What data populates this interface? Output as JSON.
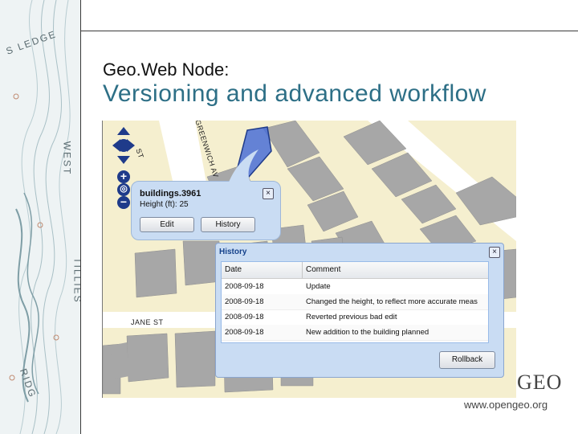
{
  "slide": {
    "subtitle": "Geo.Web Node:",
    "title": "Versioning and advanced workflow"
  },
  "decoration": {
    "topo_words": [
      "S LEDGE",
      "WEST",
      "TILLIES",
      "RIDG"
    ]
  },
  "map": {
    "streets": [
      "GREENWICH AV",
      "JANE ST",
      "ST"
    ]
  },
  "feature_popup": {
    "title": "buildings.3961",
    "height_text": "Height (ft): 25",
    "edit_label": "Edit",
    "history_label": "History",
    "close_icon": "close-icon"
  },
  "history_window": {
    "title": "History",
    "columns": [
      "Date",
      "Comment"
    ],
    "rows": [
      {
        "date": "2008-09-18",
        "comment": "Update"
      },
      {
        "date": "2008-09-18",
        "comment": "Changed the height, to reflect more accurate meas"
      },
      {
        "date": "2008-09-18",
        "comment": "Reverted previous bad edit"
      },
      {
        "date": "2008-09-18",
        "comment": "New addition to the building planned"
      }
    ],
    "rollback_label": "Rollback"
  },
  "logo": {
    "brand": "GEO",
    "url": "www.opengeo.org"
  },
  "colors": {
    "title": "#2d6f86",
    "map_bg": "#f5efcf",
    "building": "#a7a7a7",
    "selected_building": "#4a6fd6",
    "window_frame": "#c9dcf3"
  }
}
